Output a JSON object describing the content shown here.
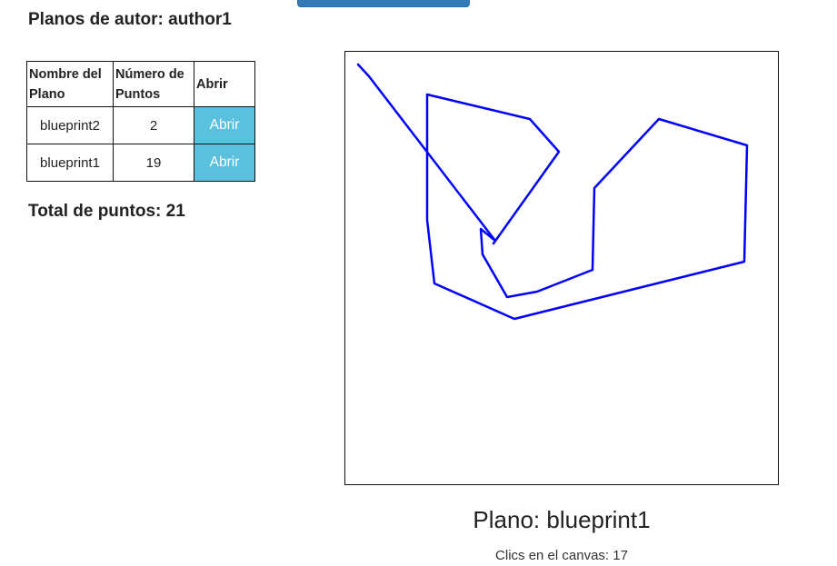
{
  "header": {
    "title_prefix": "Planos de autor:",
    "author": "author1"
  },
  "table": {
    "headers": {
      "name": "Nombre del Plano",
      "points": "Número de Puntos",
      "open": "Abrir"
    },
    "rows": [
      {
        "name": "blueprint2",
        "points": "2",
        "action": "Abrir"
      },
      {
        "name": "blueprint1",
        "points": "19",
        "action": "Abrir"
      }
    ]
  },
  "total": {
    "label": "Total de puntos:",
    "value": "21"
  },
  "canvas": {
    "stroke_color": "#0000ff",
    "points": [
      [
        14,
        14
      ],
      [
        26,
        27
      ],
      [
        165,
        208
      ],
      [
        149,
        195
      ],
      [
        151,
        223
      ],
      [
        178,
        270
      ],
      [
        211,
        264
      ],
      [
        272,
        240
      ],
      [
        274,
        150
      ],
      [
        345,
        74
      ],
      [
        442,
        103
      ],
      [
        439,
        231
      ],
      [
        186,
        294
      ],
      [
        98,
        255
      ],
      [
        90,
        185
      ],
      [
        90,
        47
      ],
      [
        203,
        74
      ],
      [
        235,
        110
      ],
      [
        163,
        211
      ]
    ]
  },
  "plan": {
    "label": "Plano:",
    "name": "blueprint1"
  },
  "clicks": {
    "label": "Clics en el canvas:",
    "count": "17"
  },
  "colors": {
    "primary_button": "#337ab7",
    "info_button": "#5bc0de",
    "line": "#0000ff"
  }
}
